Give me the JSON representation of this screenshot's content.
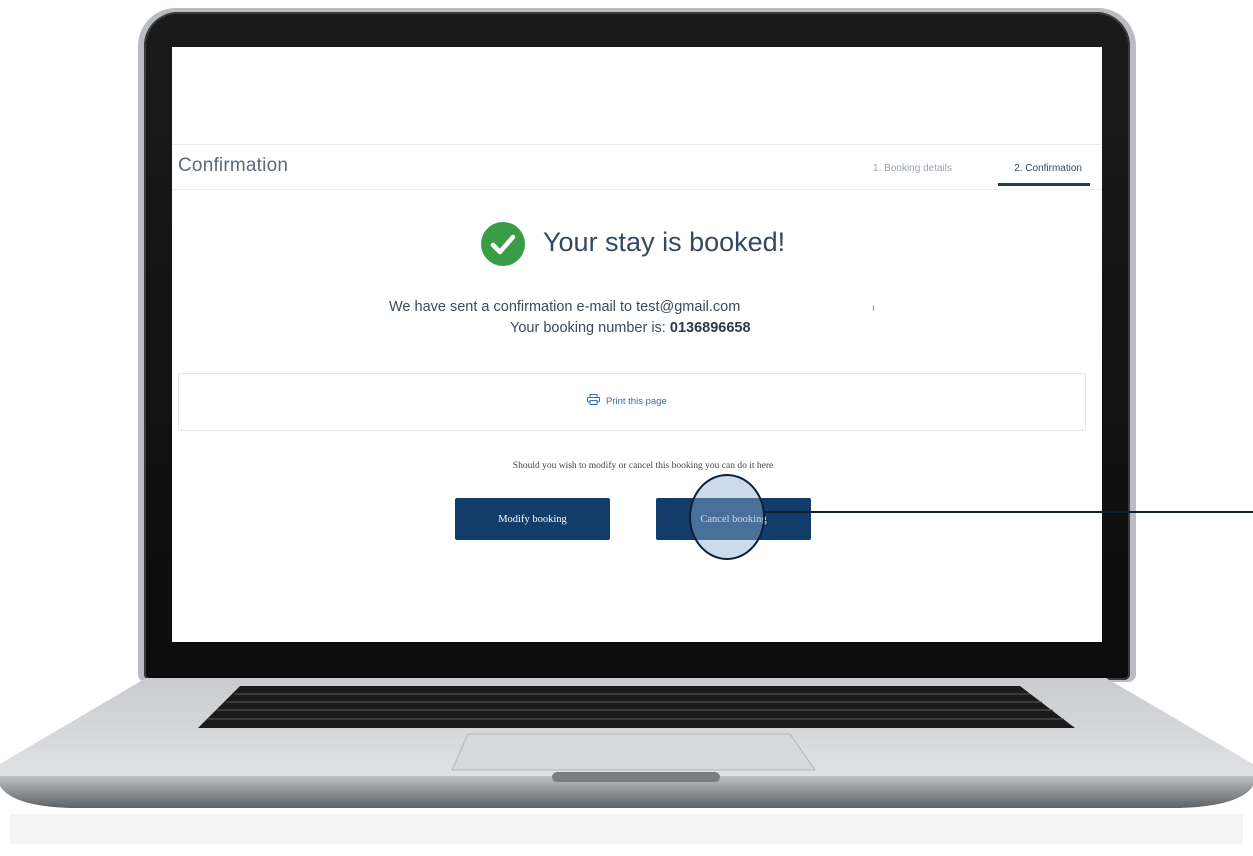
{
  "header": {
    "title": "Confirmation",
    "steps": [
      {
        "label": "1. Booking details",
        "active": false
      },
      {
        "label": "2. Confirmation",
        "active": true
      }
    ]
  },
  "success": {
    "title": "Your stay is booked!",
    "icon": "check-circle-icon",
    "icon_color": "#3a9d45"
  },
  "confirmation": {
    "email_line": "We have sent a confirmation e-mail to test@gmail.com",
    "booking_number_label": "Your booking number is:",
    "booking_number": "0136896658"
  },
  "print": {
    "label": "Print this page",
    "icon": "printer-icon"
  },
  "actions": {
    "prompt": "Should you wish to modify or cancel this booking you can do it here",
    "modify_label": "Modify booking",
    "cancel_label": "Cancel booking"
  },
  "colors": {
    "primary_button": "#123d6b",
    "link": "#2f6fb0",
    "text": "#34495e"
  }
}
